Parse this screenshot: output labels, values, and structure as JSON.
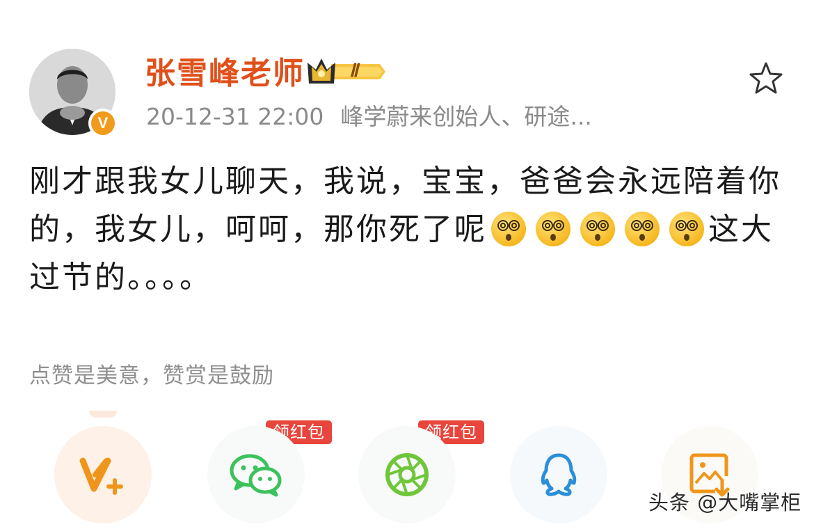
{
  "post": {
    "author": {
      "name": "张雪峰老师",
      "vip_level": "Ⅱ",
      "verified_mark": "V"
    },
    "timestamp": "20-12-31 22:00",
    "bio": "峰学蔚来创始人、研途...",
    "text_part1": "刚才跟我女儿聊天，我说，宝宝，爸爸会永远陪着你的，我女儿，呵呵，那你死了呢",
    "emoji_name": "dizzy-face-emoji",
    "emoji_count": 5,
    "text_part2": "这大过节的。。。。"
  },
  "reward": {
    "hint": "点赞是美意，赞赏是鼓励"
  },
  "share_bar": {
    "items": [
      {
        "icon": "vplus-icon",
        "badge": ""
      },
      {
        "icon": "wechat-icon",
        "badge": "领红包"
      },
      {
        "icon": "moments-icon",
        "badge": "领红包"
      },
      {
        "icon": "qq-icon",
        "badge": ""
      },
      {
        "icon": "save-image-icon",
        "badge": ""
      }
    ]
  },
  "watermark": "头条 @大嘴掌柜",
  "colors": {
    "username": "#e0501b",
    "meta": "#8a8a8a",
    "badge": "#e8453c",
    "wechat_green": "#3cc25c",
    "moments_green": "#6fc63a",
    "qq_blue": "#2a8fd8",
    "orange": "#f19a1c"
  }
}
